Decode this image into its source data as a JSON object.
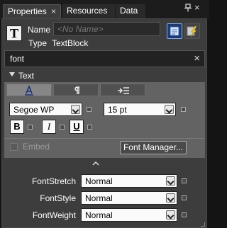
{
  "tabs": [
    {
      "label": "Properties",
      "active": true
    },
    {
      "label": "Resources",
      "active": false
    },
    {
      "label": "Data",
      "active": false
    }
  ],
  "header": {
    "name_label": "Name",
    "name_placeholder": "<No Name>",
    "type_label": "Type",
    "type_value": "TextBlock"
  },
  "search": {
    "value": "font",
    "clear_icon": "×"
  },
  "text_section": {
    "title": "Text",
    "subtabs": [
      "font-tab",
      "paragraph-tab",
      "indent-tab"
    ],
    "font_family": "Segoe WP",
    "font_size": "15 pt",
    "bold_label": "B",
    "italic_label": "I",
    "underline_label": "U",
    "embed_label": "Embed",
    "font_manager_label": "Font Manager..."
  },
  "properties": [
    {
      "label": "FontStretch",
      "value": "Normal"
    },
    {
      "label": "FontStyle",
      "value": "Normal"
    },
    {
      "label": "FontWeight",
      "value": "Normal"
    }
  ],
  "colors": {
    "panel": "#3d3d3d",
    "section": "#636363",
    "accent": "#8ab4f8"
  }
}
